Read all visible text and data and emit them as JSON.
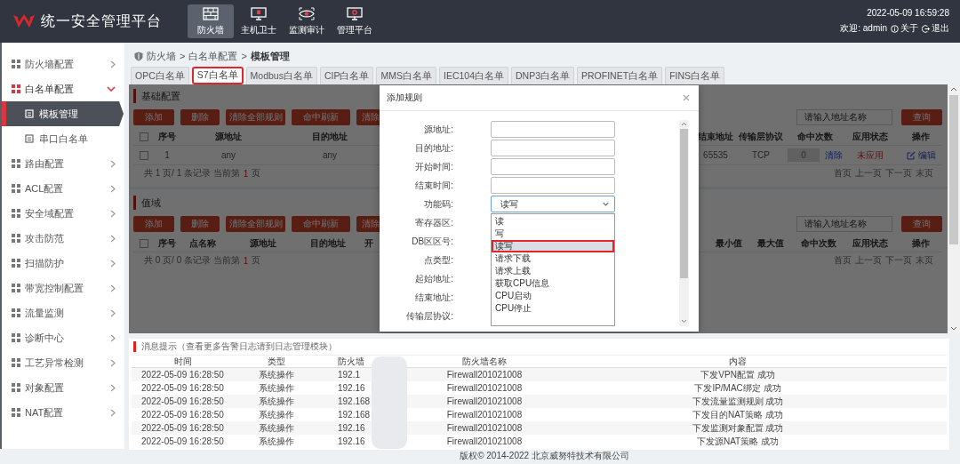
{
  "header": {
    "title": "统一安全管理平台",
    "nav": [
      {
        "label": "防火墙",
        "selected": true
      },
      {
        "label": "主机卫士",
        "selected": false
      },
      {
        "label": "监测审计",
        "selected": false
      },
      {
        "label": "管理平台",
        "selected": false
      }
    ],
    "datetime": "2022-05-09 16:59:28",
    "welcome": "欢迎: admin",
    "about": "关于",
    "logout": "退出"
  },
  "sidebar": {
    "items": [
      {
        "label": "防火墙配置",
        "expanded": false
      },
      {
        "label": "白名单配置",
        "expanded": true,
        "children": [
          {
            "label": "模板管理",
            "selected": true
          },
          {
            "label": "串口白名单",
            "selected": false
          }
        ]
      },
      {
        "label": "路由配置",
        "expanded": false
      },
      {
        "label": "ACL配置",
        "expanded": false
      },
      {
        "label": "安全域配置",
        "expanded": false
      },
      {
        "label": "攻击防范",
        "expanded": false
      },
      {
        "label": "扫描防护",
        "expanded": false
      },
      {
        "label": "带宽控制配置",
        "expanded": false
      },
      {
        "label": "流量监测",
        "expanded": false
      },
      {
        "label": "诊断中心",
        "expanded": false
      },
      {
        "label": "工艺异常检测",
        "expanded": false
      },
      {
        "label": "对象配置",
        "expanded": false
      },
      {
        "label": "NAT配置",
        "expanded": false
      }
    ]
  },
  "breadcrumb": {
    "items": [
      "防火墙",
      "白名单配置",
      "模板管理"
    ],
    "separator": ">"
  },
  "tabs": [
    {
      "label": "OPC白名单",
      "selected": false
    },
    {
      "label": "S7白名单",
      "selected": true
    },
    {
      "label": "Modbus白名单",
      "selected": false
    },
    {
      "label": "CIP白名单",
      "selected": false
    },
    {
      "label": "MMS白名单",
      "selected": false
    },
    {
      "label": "IEC104白名单",
      "selected": false
    },
    {
      "label": "DNP3白名单",
      "selected": false
    },
    {
      "label": "PROFINET白名单",
      "selected": false
    },
    {
      "label": "FINS白名单",
      "selected": false
    }
  ],
  "sections": [
    {
      "title": "基础配置",
      "buttons": [
        "添加",
        "删除",
        "清除全部规则",
        "命中刷新",
        "清除"
      ],
      "search": {
        "placeholder": "请输入地址名称",
        "button": "查询"
      },
      "all_checked": false,
      "columns": [
        "序号",
        "源地址",
        "目的地址",
        "结束地址",
        "传输层协议",
        "命中次数",
        "应用状态",
        "操作"
      ],
      "rows": [
        {
          "checked": false,
          "cells": [
            "1",
            "any",
            "any",
            "65535",
            "TCP"
          ],
          "hits": "0",
          "clear": "清除",
          "status": "未应用",
          "applied": false,
          "edit": "编辑"
        }
      ],
      "summary": {
        "text": "共 1 页/ 1 条记录 当前第",
        "page": "1",
        "suffix": "页"
      },
      "pager": [
        "首页",
        "上一页",
        "下一页",
        "末页"
      ]
    },
    {
      "title": "值域",
      "buttons": [
        "添加",
        "删除",
        "清除全部规则",
        "命中刷新",
        "清除"
      ],
      "search": {
        "placeholder": "请输入地址名称",
        "button": "查询"
      },
      "all_checked": false,
      "columns": [
        "序号",
        "点名称",
        "源地址",
        "目的地址",
        "开",
        "最小值",
        "最大值",
        "命中次数",
        "应用状态",
        "操作"
      ],
      "summary": {
        "text": "共 0 页/ 0 条记录 当前第",
        "page": "1",
        "suffix": "页"
      },
      "pager": [
        "首页",
        "上一页",
        "下一页",
        "末页"
      ]
    }
  ],
  "modal": {
    "title": "添加规则",
    "fields": [
      {
        "label": "源地址:",
        "kind": "text"
      },
      {
        "label": "目的地址:",
        "kind": "text"
      },
      {
        "label": "开始时间:",
        "kind": "text"
      },
      {
        "label": "结束时间:",
        "kind": "text"
      },
      {
        "label": "功能码:",
        "kind": "select",
        "value": "读写",
        "open": true,
        "options": [
          {
            "label": "读",
            "selected": false
          },
          {
            "label": "写",
            "selected": false
          },
          {
            "label": "读写",
            "selected": true
          },
          {
            "label": "请求下载",
            "selected": false
          },
          {
            "label": "请求上载",
            "selected": false
          },
          {
            "label": "获取CPU信息",
            "selected": false
          },
          {
            "label": "CPU启动",
            "selected": false
          },
          {
            "label": "CPU停止",
            "selected": false
          }
        ]
      },
      {
        "label": "寄存器区:"
      },
      {
        "label": "DB区区号:"
      },
      {
        "label": "点类型:"
      },
      {
        "label": "起始地址:"
      },
      {
        "label": "结束地址:"
      },
      {
        "label": "传输层协议:"
      }
    ]
  },
  "messages": {
    "title": "消息提示（查看更多告警日志请到日志管理模块）",
    "columns": [
      "时间",
      "类型",
      "防火墙",
      "防火墙名称",
      "内容"
    ],
    "rows": [
      {
        "time": "2022-05-09 16:28:50",
        "type": "系统操作",
        "ip": "192.1",
        "name": "Firewall201021008",
        "content": "下发VPN配置 成功"
      },
      {
        "time": "2022-05-09 16:28:50",
        "type": "系统操作",
        "ip": "192.16",
        "name": "Firewall201021008",
        "content": "下发IP/MAC绑定 成功"
      },
      {
        "time": "2022-05-09 16:28:50",
        "type": "系统操作",
        "ip": "192.168",
        "name": "Firewall201021008",
        "content": "下发流量监测规则 成功"
      },
      {
        "time": "2022-05-09 16:28:50",
        "type": "系统操作",
        "ip": "192.168",
        "name": "Firewall201021008",
        "content": "下发目的NAT策略 成功"
      },
      {
        "time": "2022-05-09 16:28:50",
        "type": "系统操作",
        "ip": "192.16",
        "name": "Firewall201021008",
        "content": "下发监测对象配置 成功"
      },
      {
        "time": "2022-05-09 16:28:50",
        "type": "系统操作",
        "ip": "192.16",
        "name": "Firewall201021008",
        "content": "下发源NAT策略 成功"
      }
    ]
  },
  "footer": "版权© 2014-2022 北京威努特技术有限公司"
}
